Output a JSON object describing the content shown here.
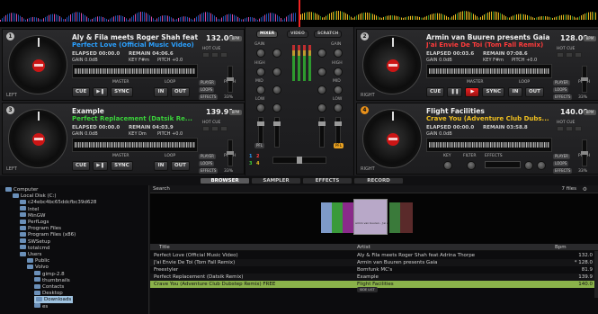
{
  "decks": [
    {
      "number": "1",
      "side": "LEFT",
      "artist": "Aly & Fila meets Roger Shah feat...",
      "title": "Perfect Love (Official Music Video)",
      "title_color": "#2aa0ff",
      "bpm": "132.00",
      "elapsed": "ELAPSED 00:00.0",
      "remain": "REMAIN 04:06.6",
      "gain": "GAIN 0.0dB",
      "key": "KEY F#m",
      "pitch": "PITCH +0.0",
      "pitch_pct": "33%"
    },
    {
      "number": "2",
      "side": "RIGHT",
      "artist": "Armin van Buuren presents Gaia",
      "title": "J'ai Envie De Toi (Tom Fall Remix)",
      "title_color": "#ff3b3b",
      "bpm": "128.00",
      "elapsed": "ELAPSED 00:03.6",
      "remain": "REMAIN 07:08.6",
      "gain": "GAIN 0.0dB",
      "key": "KEY F#m",
      "pitch": "PITCH +0.0",
      "pitch_pct": "33%"
    },
    {
      "number": "3",
      "side": "LEFT",
      "artist": "Example",
      "title": "Perfect Replacement (Datsik Re...",
      "title_color": "#3ad13a",
      "bpm": "139.91",
      "elapsed": "ELAPSED 00:00.0",
      "remain": "REMAIN 04:03.9",
      "gain": "GAIN 0.0dB",
      "key": "KEY Dm",
      "pitch": "PITCH +0.0",
      "pitch_pct": "33%"
    },
    {
      "number": "4",
      "side": "RIGHT",
      "artist": "Flight Facilities",
      "title": "Crave You (Adventure Club Dubs...",
      "title_color": "#f0c020",
      "bpm": "140.00",
      "elapsed": "ELAPSED 00:00.0",
      "remain": "REMAIN 03:58.8",
      "gain": "GAIN 0.0dB",
      "key": "",
      "pitch": "",
      "pitch_pct": "33%"
    }
  ],
  "deck_labels": {
    "hot_cue": "HOT CUE",
    "master": "MASTER",
    "loop": "LOOP",
    "pitch": "PITCH",
    "player": "PLAYER",
    "loops": "LOOPS",
    "effects": "EFFECTS",
    "bpm_tag": "BPM",
    "cue": "CUE",
    "sync": "SYNC",
    "in": "IN",
    "out": "OUT",
    "key": "KEY",
    "filter": "FILTER"
  },
  "mixer": {
    "tabs": [
      "MIXER",
      "VIDEO",
      "SCRATCH"
    ],
    "active_tab": "MIXER",
    "gain": "GAIN",
    "high": "HIGH",
    "mid": "MID",
    "low": "LOW",
    "pfl": "PFL",
    "left_nums": [
      "1",
      "3"
    ],
    "right_nums": [
      "2",
      "4"
    ]
  },
  "browser_tabs": [
    "BROWSER",
    "SAMPLER",
    "EFFECTS",
    "RECORD"
  ],
  "active_browser_tab": "BROWSER",
  "tree": [
    {
      "label": "Computer",
      "indent": 0
    },
    {
      "label": "Local Disk (C:)",
      "indent": 1
    },
    {
      "label": "c24ebc4bc65ddcfbc39d628",
      "indent": 2
    },
    {
      "label": "Intel",
      "indent": 2
    },
    {
      "label": "MinGW",
      "indent": 2
    },
    {
      "label": "PerfLogs",
      "indent": 2
    },
    {
      "label": "Program Files",
      "indent": 2
    },
    {
      "label": "Program Files (x86)",
      "indent": 2
    },
    {
      "label": "SWSetup",
      "indent": 2
    },
    {
      "label": "totalcmd",
      "indent": 2
    },
    {
      "label": "Users",
      "indent": 2
    },
    {
      "label": "Public",
      "indent": 3
    },
    {
      "label": "Volvo",
      "indent": 3
    },
    {
      "label": "gimp-2.8",
      "indent": 4
    },
    {
      "label": "thumbnails",
      "indent": 4
    },
    {
      "label": "Contacts",
      "indent": 4
    },
    {
      "label": "Desktop",
      "indent": 4
    },
    {
      "label": "Downloads",
      "indent": 4,
      "selected": true
    },
    {
      "label": "es",
      "indent": 4
    }
  ],
  "browser": {
    "search_label": "Search",
    "file_count": "7 files",
    "columns": {
      "title": "Title",
      "artist": "Artist",
      "bpm": "Bpm"
    },
    "rows": [
      {
        "title": "Perfect Love (Official Music Video)",
        "artist": "Aly & Fila meets Roger Shah feat Adrina Thorpe",
        "bpm": "132.0"
      },
      {
        "title": "J'ai Envie De Toi (Tom Fall Remix)",
        "artist": "Armin van Buuren presents Gaia",
        "bpm": "* 128.0"
      },
      {
        "title": "Freestyler",
        "artist": "Bomfunk MC's",
        "bpm": "81.9"
      },
      {
        "title": "Perfect Replacement (Datsik Remix)",
        "artist": "Example",
        "bpm": "139.9"
      },
      {
        "title": "Crave You (Adventure Club Dubstep Remix)  FREE",
        "artist": "Flight Facilities",
        "bpm": "140.0",
        "selected": true
      }
    ],
    "cover_label": "armin van buuren - j'ai envie de toi",
    "small_button": "SIDE LIST"
  },
  "colors": {
    "accent_red": "#cc1515",
    "selected_row": "#8ab24a",
    "tree_selected": "#9fc3e0"
  }
}
